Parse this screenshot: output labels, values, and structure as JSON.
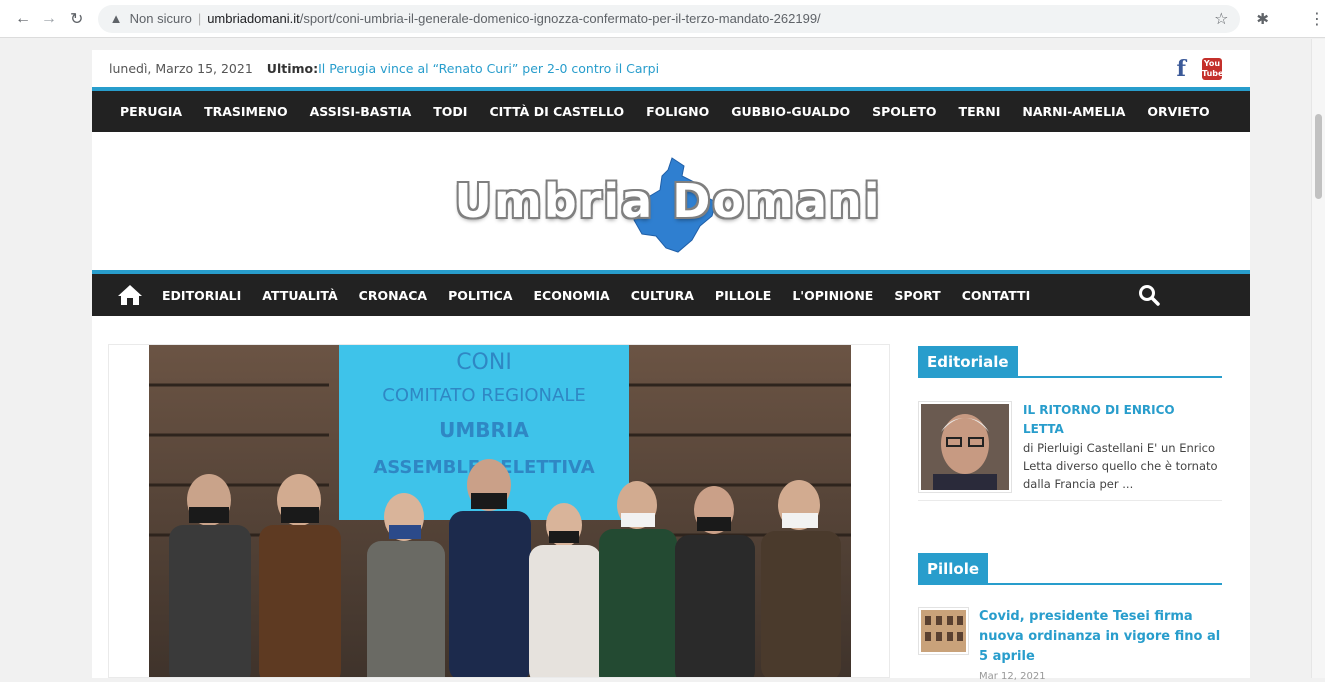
{
  "browser": {
    "insecure_label": "Non sicuro",
    "url_domain": "umbriadomani.it",
    "url_path": "/sport/coni-umbria-il-generale-domenico-ignozza-confermato-per-il-terzo-mandato-262199/"
  },
  "topbar": {
    "date": "lunedì, Marzo 15, 2021",
    "latest_label": "Ultimo:",
    "latest_link": "Il Perugia vince al “Renato Curi” per 2-0 contro il Carpi",
    "youtube_icon_text": "You Tube"
  },
  "cities": [
    "PERUGIA",
    "TRASIMENO",
    "ASSISI-BASTIA",
    "TODI",
    "CITTÀ DI CASTELLO",
    "FOLIGNO",
    "GUBBIO-GUALDO",
    "SPOLETO",
    "TERNI",
    "NARNI-AMELIA",
    "ORVIETO"
  ],
  "logo": {
    "text": "Umbria Domani"
  },
  "nav": [
    "EDITORIALI",
    "ATTUALITÀ",
    "CRONACA",
    "POLITICA",
    "ECONOMIA",
    "CULTURA",
    "PILLOLE",
    "L'OPINIONE",
    "SPORT",
    "CONTATTI"
  ],
  "photo": {
    "banner_lines": [
      "CONI",
      "COMITATO REGIONALE",
      "UMBRIA",
      "ASSEMBLEA ELETTIVA"
    ]
  },
  "sidebar": {
    "editoriale": {
      "title": "Editoriale",
      "post_title": "IL RITORNO DI ENRICO LETTA",
      "excerpt": "di Pierluigi Castellani E' un Enrico Letta diverso quello che è tornato dalla Francia per ..."
    },
    "pillole": {
      "title": "Pillole",
      "post_title": "Covid, presidente Tesei firma nuova ordinanza in vigore fino al 5 aprile",
      "date": "Mar 12, 2021"
    }
  },
  "colors": {
    "accent": "#289dcc",
    "nav_bg": "#222222"
  }
}
